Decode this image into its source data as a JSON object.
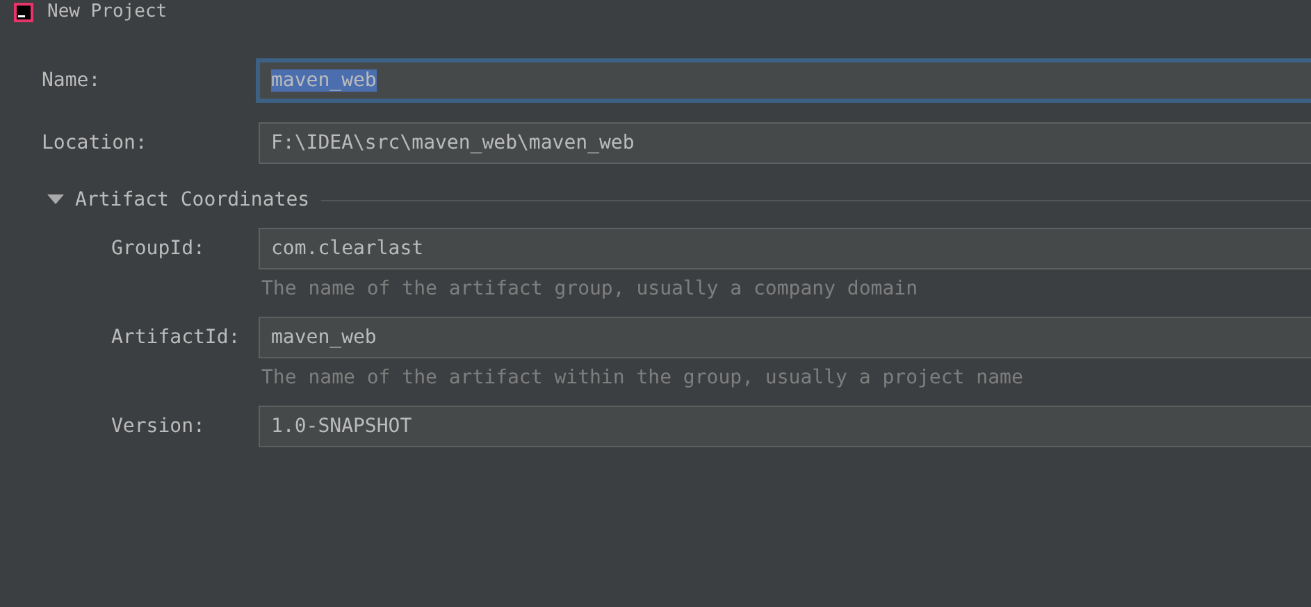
{
  "window": {
    "title": "New Project"
  },
  "fields": [
    {
      "label": "Name:",
      "value": "maven_web",
      "focused": true
    },
    {
      "label": "Location:",
      "value": "F:\\IDEA\\src\\maven_web\\maven_web",
      "focused": false
    }
  ],
  "section": {
    "title": "Artifact Coordinates",
    "expanded": true,
    "fields": [
      {
        "label": "GroupId:",
        "value": "com.clearlast",
        "hint": "The name of the artifact group, usually a company domain"
      },
      {
        "label": "ArtifactId:",
        "value": "maven_web",
        "hint": "The name of the artifact within the group, usually a project name"
      },
      {
        "label": "Version:",
        "value": "1.0-SNAPSHOT"
      }
    ]
  }
}
